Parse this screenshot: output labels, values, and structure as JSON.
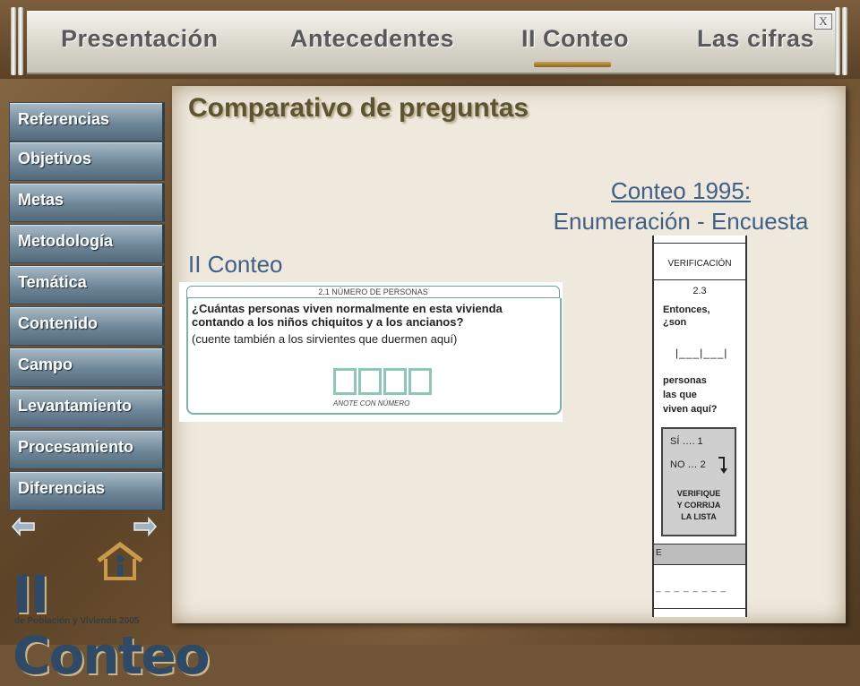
{
  "window": {
    "close_label": "X"
  },
  "nav": {
    "items": [
      {
        "label": "Presentación"
      },
      {
        "label": "Antecedentes"
      },
      {
        "label": "II Conteo"
      },
      {
        "label": "Las cifras"
      }
    ]
  },
  "sidebar": {
    "items": [
      {
        "label": "Referencias"
      },
      {
        "label": "Objetivos"
      },
      {
        "label": "Metas"
      },
      {
        "label": "Metodología"
      },
      {
        "label": "Temática"
      },
      {
        "label": "Contenido"
      },
      {
        "label": "Campo"
      },
      {
        "label": "Levantamiento"
      },
      {
        "label": "Procesamiento"
      },
      {
        "label": "Diferencias"
      }
    ]
  },
  "logo": {
    "title": "II Conteo",
    "subtitle": "de Población y Vivienda 2005"
  },
  "main": {
    "title": "Comparativo de preguntas",
    "conteo95_line1": "Conteo 1995:",
    "conteo95_line2": "Enumeración - Encuesta",
    "ii_conteo_label": "II Conteo",
    "form1": {
      "header": "2.1 NÚMERO DE PERSONAS",
      "question_line1": "¿Cuántas personas viven normalmente en esta vivienda",
      "question_line2": "contando a los niños chiquitos y a los ancianos?",
      "instruction": "(cuente también a los sirvientes que duermen aquí)",
      "note": "ANOTE CON NÚMERO"
    },
    "form2": {
      "header": "VERIFICACIÓN",
      "number": "2.3",
      "text1_line1": "Entonces,",
      "text1_line2": "¿son",
      "brackets": "|___|___|",
      "text2_line1": "personas",
      "text2_line2": "las que",
      "text2_line3": "viven aquí?",
      "opt_si": "SÍ ….  1",
      "opt_no": "NO …  2",
      "verify_line1": "VERIFIQUE",
      "verify_line2": "Y CORRIJA",
      "verify_line3": "LA LISTA",
      "sep_label": "E",
      "dashes": "_ _ _ _ _ _ _ _"
    }
  }
}
